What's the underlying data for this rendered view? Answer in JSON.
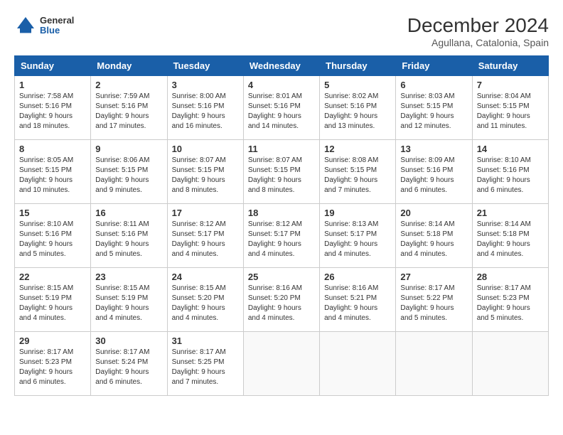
{
  "header": {
    "logo_general": "General",
    "logo_blue": "Blue",
    "title": "December 2024",
    "subtitle": "Agullana, Catalonia, Spain"
  },
  "calendar": {
    "days_of_week": [
      "Sunday",
      "Monday",
      "Tuesday",
      "Wednesday",
      "Thursday",
      "Friday",
      "Saturday"
    ],
    "weeks": [
      [
        {
          "day": null
        },
        {
          "day": null
        },
        {
          "day": null
        },
        {
          "day": null
        },
        {
          "day": null
        },
        {
          "day": null
        },
        {
          "day": null
        }
      ]
    ],
    "cells": [
      {
        "date": "1",
        "sunrise": "7:58 AM",
        "sunset": "5:16 PM",
        "daylight": "9 hours and 18 minutes."
      },
      {
        "date": "2",
        "sunrise": "7:59 AM",
        "sunset": "5:16 PM",
        "daylight": "9 hours and 17 minutes."
      },
      {
        "date": "3",
        "sunrise": "8:00 AM",
        "sunset": "5:16 PM",
        "daylight": "9 hours and 16 minutes."
      },
      {
        "date": "4",
        "sunrise": "8:01 AM",
        "sunset": "5:16 PM",
        "daylight": "9 hours and 14 minutes."
      },
      {
        "date": "5",
        "sunrise": "8:02 AM",
        "sunset": "5:16 PM",
        "daylight": "9 hours and 13 minutes."
      },
      {
        "date": "6",
        "sunrise": "8:03 AM",
        "sunset": "5:15 PM",
        "daylight": "9 hours and 12 minutes."
      },
      {
        "date": "7",
        "sunrise": "8:04 AM",
        "sunset": "5:15 PM",
        "daylight": "9 hours and 11 minutes."
      },
      {
        "date": "8",
        "sunrise": "8:05 AM",
        "sunset": "5:15 PM",
        "daylight": "9 hours and 10 minutes."
      },
      {
        "date": "9",
        "sunrise": "8:06 AM",
        "sunset": "5:15 PM",
        "daylight": "9 hours and 9 minutes."
      },
      {
        "date": "10",
        "sunrise": "8:07 AM",
        "sunset": "5:15 PM",
        "daylight": "9 hours and 8 minutes."
      },
      {
        "date": "11",
        "sunrise": "8:07 AM",
        "sunset": "5:15 PM",
        "daylight": "9 hours and 8 minutes."
      },
      {
        "date": "12",
        "sunrise": "8:08 AM",
        "sunset": "5:15 PM",
        "daylight": "9 hours and 7 minutes."
      },
      {
        "date": "13",
        "sunrise": "8:09 AM",
        "sunset": "5:16 PM",
        "daylight": "9 hours and 6 minutes."
      },
      {
        "date": "14",
        "sunrise": "8:10 AM",
        "sunset": "5:16 PM",
        "daylight": "9 hours and 6 minutes."
      },
      {
        "date": "15",
        "sunrise": "8:10 AM",
        "sunset": "5:16 PM",
        "daylight": "9 hours and 5 minutes."
      },
      {
        "date": "16",
        "sunrise": "8:11 AM",
        "sunset": "5:16 PM",
        "daylight": "9 hours and 5 minutes."
      },
      {
        "date": "17",
        "sunrise": "8:12 AM",
        "sunset": "5:17 PM",
        "daylight": "9 hours and 4 minutes."
      },
      {
        "date": "18",
        "sunrise": "8:12 AM",
        "sunset": "5:17 PM",
        "daylight": "9 hours and 4 minutes."
      },
      {
        "date": "19",
        "sunrise": "8:13 AM",
        "sunset": "5:17 PM",
        "daylight": "9 hours and 4 minutes."
      },
      {
        "date": "20",
        "sunrise": "8:14 AM",
        "sunset": "5:18 PM",
        "daylight": "9 hours and 4 minutes."
      },
      {
        "date": "21",
        "sunrise": "8:14 AM",
        "sunset": "5:18 PM",
        "daylight": "9 hours and 4 minutes."
      },
      {
        "date": "22",
        "sunrise": "8:15 AM",
        "sunset": "5:19 PM",
        "daylight": "9 hours and 4 minutes."
      },
      {
        "date": "23",
        "sunrise": "8:15 AM",
        "sunset": "5:19 PM",
        "daylight": "9 hours and 4 minutes."
      },
      {
        "date": "24",
        "sunrise": "8:15 AM",
        "sunset": "5:20 PM",
        "daylight": "9 hours and 4 minutes."
      },
      {
        "date": "25",
        "sunrise": "8:16 AM",
        "sunset": "5:20 PM",
        "daylight": "9 hours and 4 minutes."
      },
      {
        "date": "26",
        "sunrise": "8:16 AM",
        "sunset": "5:21 PM",
        "daylight": "9 hours and 4 minutes."
      },
      {
        "date": "27",
        "sunrise": "8:17 AM",
        "sunset": "5:22 PM",
        "daylight": "9 hours and 5 minutes."
      },
      {
        "date": "28",
        "sunrise": "8:17 AM",
        "sunset": "5:23 PM",
        "daylight": "9 hours and 5 minutes."
      },
      {
        "date": "29",
        "sunrise": "8:17 AM",
        "sunset": "5:23 PM",
        "daylight": "9 hours and 6 minutes."
      },
      {
        "date": "30",
        "sunrise": "8:17 AM",
        "sunset": "5:24 PM",
        "daylight": "9 hours and 6 minutes."
      },
      {
        "date": "31",
        "sunrise": "8:17 AM",
        "sunset": "5:25 PM",
        "daylight": "9 hours and 7 minutes."
      }
    ],
    "start_day_of_week": 0,
    "labels": {
      "sunrise": "Sunrise:",
      "sunset": "Sunset:",
      "daylight": "Daylight:"
    }
  }
}
